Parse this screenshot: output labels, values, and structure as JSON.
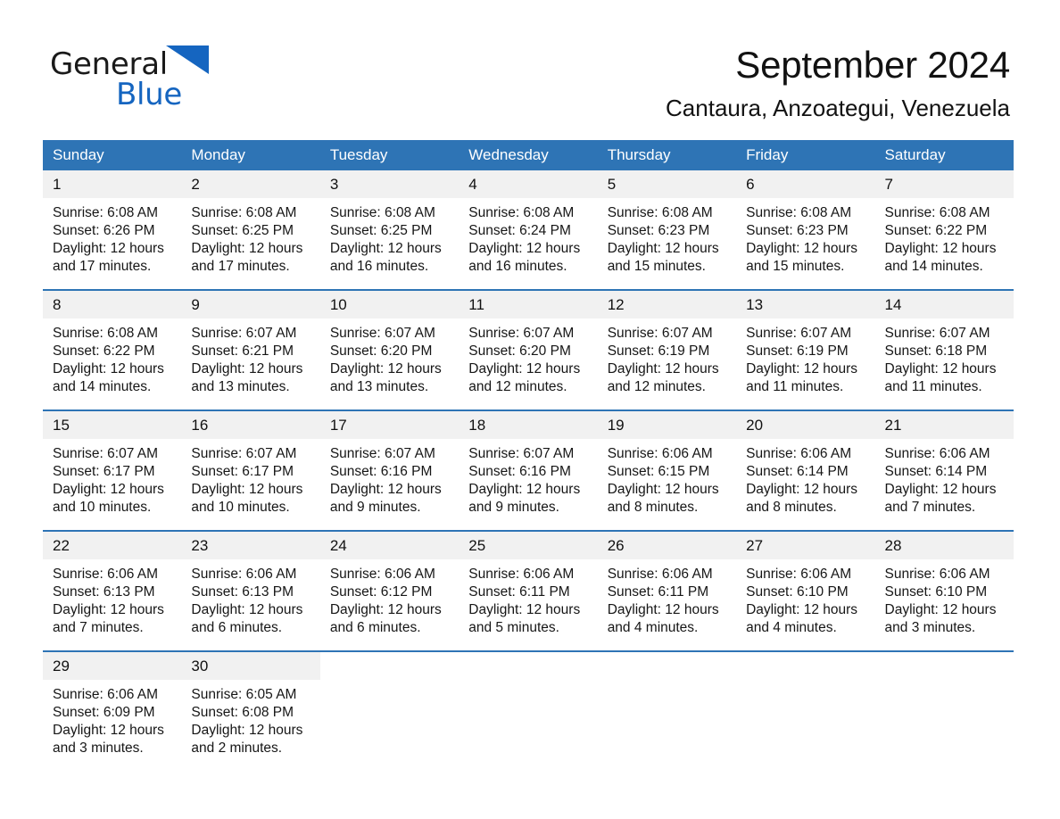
{
  "brand": {
    "name_part1": "General",
    "name_part2": "Blue",
    "logo_icon": "triangle-icon",
    "accent_color": "#1565c0"
  },
  "header": {
    "title": "September 2024",
    "subtitle": "Cantaura, Anzoategui, Venezuela"
  },
  "theme": {
    "header_blue": "#2E74B5",
    "daynum_band": "#F1F1F1",
    "text": "#161616"
  },
  "calendar": {
    "weekdays": [
      "Sunday",
      "Monday",
      "Tuesday",
      "Wednesday",
      "Thursday",
      "Friday",
      "Saturday"
    ],
    "weeks": [
      [
        {
          "day": "1",
          "sunrise": "Sunrise: 6:08 AM",
          "sunset": "Sunset: 6:26 PM",
          "daylight_line1": "Daylight: 12 hours",
          "daylight_line2": "and 17 minutes."
        },
        {
          "day": "2",
          "sunrise": "Sunrise: 6:08 AM",
          "sunset": "Sunset: 6:25 PM",
          "daylight_line1": "Daylight: 12 hours",
          "daylight_line2": "and 17 minutes."
        },
        {
          "day": "3",
          "sunrise": "Sunrise: 6:08 AM",
          "sunset": "Sunset: 6:25 PM",
          "daylight_line1": "Daylight: 12 hours",
          "daylight_line2": "and 16 minutes."
        },
        {
          "day": "4",
          "sunrise": "Sunrise: 6:08 AM",
          "sunset": "Sunset: 6:24 PM",
          "daylight_line1": "Daylight: 12 hours",
          "daylight_line2": "and 16 minutes."
        },
        {
          "day": "5",
          "sunrise": "Sunrise: 6:08 AM",
          "sunset": "Sunset: 6:23 PM",
          "daylight_line1": "Daylight: 12 hours",
          "daylight_line2": "and 15 minutes."
        },
        {
          "day": "6",
          "sunrise": "Sunrise: 6:08 AM",
          "sunset": "Sunset: 6:23 PM",
          "daylight_line1": "Daylight: 12 hours",
          "daylight_line2": "and 15 minutes."
        },
        {
          "day": "7",
          "sunrise": "Sunrise: 6:08 AM",
          "sunset": "Sunset: 6:22 PM",
          "daylight_line1": "Daylight: 12 hours",
          "daylight_line2": "and 14 minutes."
        }
      ],
      [
        {
          "day": "8",
          "sunrise": "Sunrise: 6:08 AM",
          "sunset": "Sunset: 6:22 PM",
          "daylight_line1": "Daylight: 12 hours",
          "daylight_line2": "and 14 minutes."
        },
        {
          "day": "9",
          "sunrise": "Sunrise: 6:07 AM",
          "sunset": "Sunset: 6:21 PM",
          "daylight_line1": "Daylight: 12 hours",
          "daylight_line2": "and 13 minutes."
        },
        {
          "day": "10",
          "sunrise": "Sunrise: 6:07 AM",
          "sunset": "Sunset: 6:20 PM",
          "daylight_line1": "Daylight: 12 hours",
          "daylight_line2": "and 13 minutes."
        },
        {
          "day": "11",
          "sunrise": "Sunrise: 6:07 AM",
          "sunset": "Sunset: 6:20 PM",
          "daylight_line1": "Daylight: 12 hours",
          "daylight_line2": "and 12 minutes."
        },
        {
          "day": "12",
          "sunrise": "Sunrise: 6:07 AM",
          "sunset": "Sunset: 6:19 PM",
          "daylight_line1": "Daylight: 12 hours",
          "daylight_line2": "and 12 minutes."
        },
        {
          "day": "13",
          "sunrise": "Sunrise: 6:07 AM",
          "sunset": "Sunset: 6:19 PM",
          "daylight_line1": "Daylight: 12 hours",
          "daylight_line2": "and 11 minutes."
        },
        {
          "day": "14",
          "sunrise": "Sunrise: 6:07 AM",
          "sunset": "Sunset: 6:18 PM",
          "daylight_line1": "Daylight: 12 hours",
          "daylight_line2": "and 11 minutes."
        }
      ],
      [
        {
          "day": "15",
          "sunrise": "Sunrise: 6:07 AM",
          "sunset": "Sunset: 6:17 PM",
          "daylight_line1": "Daylight: 12 hours",
          "daylight_line2": "and 10 minutes."
        },
        {
          "day": "16",
          "sunrise": "Sunrise: 6:07 AM",
          "sunset": "Sunset: 6:17 PM",
          "daylight_line1": "Daylight: 12 hours",
          "daylight_line2": "and 10 minutes."
        },
        {
          "day": "17",
          "sunrise": "Sunrise: 6:07 AM",
          "sunset": "Sunset: 6:16 PM",
          "daylight_line1": "Daylight: 12 hours",
          "daylight_line2": "and 9 minutes."
        },
        {
          "day": "18",
          "sunrise": "Sunrise: 6:07 AM",
          "sunset": "Sunset: 6:16 PM",
          "daylight_line1": "Daylight: 12 hours",
          "daylight_line2": "and 9 minutes."
        },
        {
          "day": "19",
          "sunrise": "Sunrise: 6:06 AM",
          "sunset": "Sunset: 6:15 PM",
          "daylight_line1": "Daylight: 12 hours",
          "daylight_line2": "and 8 minutes."
        },
        {
          "day": "20",
          "sunrise": "Sunrise: 6:06 AM",
          "sunset": "Sunset: 6:14 PM",
          "daylight_line1": "Daylight: 12 hours",
          "daylight_line2": "and 8 minutes."
        },
        {
          "day": "21",
          "sunrise": "Sunrise: 6:06 AM",
          "sunset": "Sunset: 6:14 PM",
          "daylight_line1": "Daylight: 12 hours",
          "daylight_line2": "and 7 minutes."
        }
      ],
      [
        {
          "day": "22",
          "sunrise": "Sunrise: 6:06 AM",
          "sunset": "Sunset: 6:13 PM",
          "daylight_line1": "Daylight: 12 hours",
          "daylight_line2": "and 7 minutes."
        },
        {
          "day": "23",
          "sunrise": "Sunrise: 6:06 AM",
          "sunset": "Sunset: 6:13 PM",
          "daylight_line1": "Daylight: 12 hours",
          "daylight_line2": "and 6 minutes."
        },
        {
          "day": "24",
          "sunrise": "Sunrise: 6:06 AM",
          "sunset": "Sunset: 6:12 PM",
          "daylight_line1": "Daylight: 12 hours",
          "daylight_line2": "and 6 minutes."
        },
        {
          "day": "25",
          "sunrise": "Sunrise: 6:06 AM",
          "sunset": "Sunset: 6:11 PM",
          "daylight_line1": "Daylight: 12 hours",
          "daylight_line2": "and 5 minutes."
        },
        {
          "day": "26",
          "sunrise": "Sunrise: 6:06 AM",
          "sunset": "Sunset: 6:11 PM",
          "daylight_line1": "Daylight: 12 hours",
          "daylight_line2": "and 4 minutes."
        },
        {
          "day": "27",
          "sunrise": "Sunrise: 6:06 AM",
          "sunset": "Sunset: 6:10 PM",
          "daylight_line1": "Daylight: 12 hours",
          "daylight_line2": "and 4 minutes."
        },
        {
          "day": "28",
          "sunrise": "Sunrise: 6:06 AM",
          "sunset": "Sunset: 6:10 PM",
          "daylight_line1": "Daylight: 12 hours",
          "daylight_line2": "and 3 minutes."
        }
      ],
      [
        {
          "day": "29",
          "sunrise": "Sunrise: 6:06 AM",
          "sunset": "Sunset: 6:09 PM",
          "daylight_line1": "Daylight: 12 hours",
          "daylight_line2": "and 3 minutes."
        },
        {
          "day": "30",
          "sunrise": "Sunrise: 6:05 AM",
          "sunset": "Sunset: 6:08 PM",
          "daylight_line1": "Daylight: 12 hours",
          "daylight_line2": "and 2 minutes."
        },
        {
          "day": "",
          "sunrise": "",
          "sunset": "",
          "daylight_line1": "",
          "daylight_line2": "",
          "blank": true
        },
        {
          "day": "",
          "sunrise": "",
          "sunset": "",
          "daylight_line1": "",
          "daylight_line2": "",
          "blank": true
        },
        {
          "day": "",
          "sunrise": "",
          "sunset": "",
          "daylight_line1": "",
          "daylight_line2": "",
          "blank": true
        },
        {
          "day": "",
          "sunrise": "",
          "sunset": "",
          "daylight_line1": "",
          "daylight_line2": "",
          "blank": true
        },
        {
          "day": "",
          "sunrise": "",
          "sunset": "",
          "daylight_line1": "",
          "daylight_line2": "",
          "blank": true
        }
      ]
    ]
  }
}
